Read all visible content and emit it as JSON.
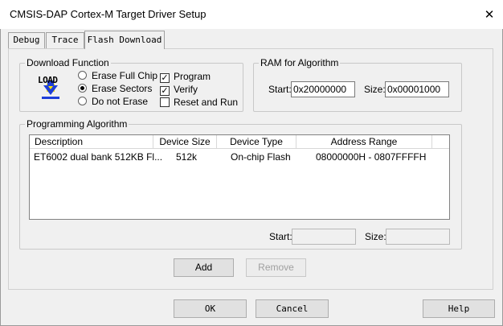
{
  "window": {
    "title": "CMSIS-DAP Cortex-M Target Driver Setup",
    "close_glyph": "✕"
  },
  "tabs": [
    {
      "label": "Debug",
      "active": false
    },
    {
      "label": "Trace",
      "active": false
    },
    {
      "label": "Flash Download",
      "active": true
    }
  ],
  "download_function": {
    "title": "Download Function",
    "icon": "load-icon",
    "icon_text": "LOAD",
    "radios": [
      {
        "label": "Erase Full Chip",
        "selected": false
      },
      {
        "label": "Erase Sectors",
        "selected": true
      },
      {
        "label": "Do not Erase",
        "selected": false
      }
    ],
    "checkboxes": [
      {
        "label": "Program",
        "checked": true
      },
      {
        "label": "Verify",
        "checked": true
      },
      {
        "label": "Reset and Run",
        "checked": false
      }
    ]
  },
  "ram_algorithm": {
    "title": "RAM for Algorithm",
    "start_label": "Start:",
    "start_value": "0x20000000",
    "size_label": "Size:",
    "size_value": "0x00001000"
  },
  "programming_algorithm": {
    "title": "Programming Algorithm",
    "columns": [
      "Description",
      "Device Size",
      "Device Type",
      "Address Range"
    ],
    "rows": [
      {
        "description": "ET6002 dual bank 512KB Fl...",
        "size": "512k",
        "type": "On-chip Flash",
        "range": "08000000H - 0807FFFFH"
      }
    ],
    "start_label": "Start:",
    "start_value": "",
    "size_label": "Size:",
    "size_value": "",
    "add_label": "Add",
    "remove_label": "Remove"
  },
  "footer": {
    "ok_label": "OK",
    "cancel_label": "Cancel",
    "help_label": "Help"
  },
  "colors": {
    "load_icon_blue": "#1f3fd8",
    "load_icon_yellow": "#ffe600"
  }
}
